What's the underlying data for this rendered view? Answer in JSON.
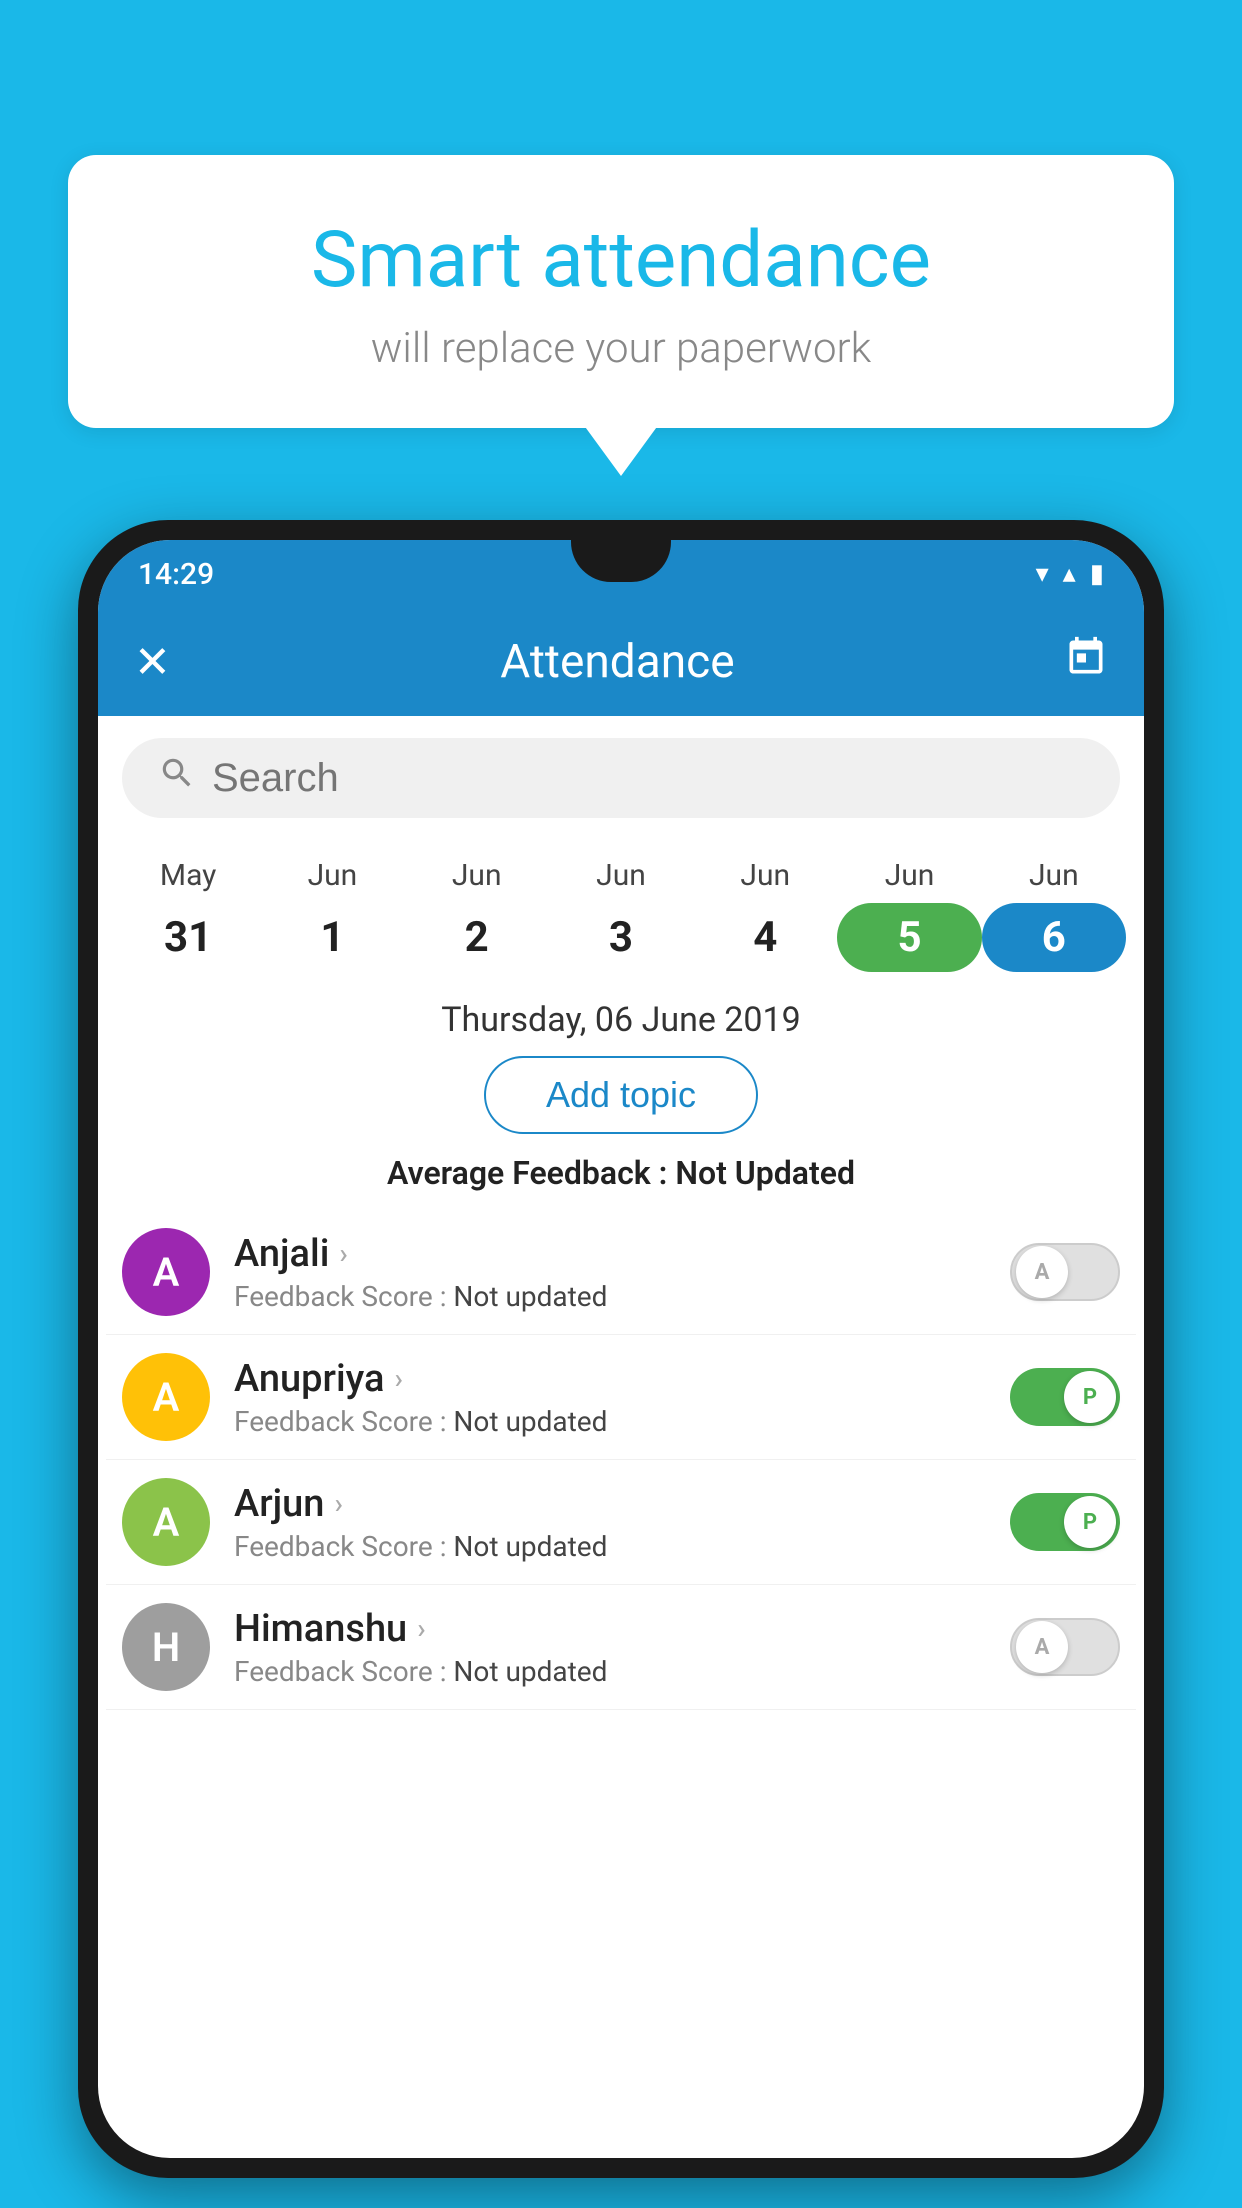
{
  "background_color": "#1ab8e8",
  "bubble": {
    "title": "Smart attendance",
    "subtitle": "will replace your paperwork"
  },
  "phone": {
    "status_bar": {
      "time": "14:29",
      "wifi_icon": "▼",
      "signal_icon": "▲",
      "battery_icon": "▮"
    },
    "app_bar": {
      "close_label": "✕",
      "title": "Attendance",
      "calendar_label": "📅"
    },
    "search": {
      "placeholder": "Search"
    },
    "calendar": {
      "months": [
        "May",
        "Jun",
        "Jun",
        "Jun",
        "Jun",
        "Jun",
        "Jun"
      ],
      "dates": [
        "31",
        "1",
        "2",
        "3",
        "4",
        "5",
        "6"
      ],
      "today_index": 5,
      "selected_index": 6,
      "selected_date_label": "Thursday, 06 June 2019"
    },
    "add_topic_label": "Add topic",
    "average_feedback": {
      "label": "Average Feedback : ",
      "value": "Not Updated"
    },
    "students": [
      {
        "name": "Anjali",
        "avatar_letter": "A",
        "avatar_color": "#9c27b0",
        "feedback_label": "Feedback Score : ",
        "feedback_value": "Not updated",
        "toggle_state": "off",
        "toggle_letter": "A"
      },
      {
        "name": "Anupriya",
        "avatar_letter": "A",
        "avatar_color": "#ffc107",
        "feedback_label": "Feedback Score : ",
        "feedback_value": "Not updated",
        "toggle_state": "on",
        "toggle_letter": "P"
      },
      {
        "name": "Arjun",
        "avatar_letter": "A",
        "avatar_color": "#8bc34a",
        "feedback_label": "Feedback Score : ",
        "feedback_value": "Not updated",
        "toggle_state": "on",
        "toggle_letter": "P"
      },
      {
        "name": "Himanshu",
        "avatar_letter": "H",
        "avatar_color": "#9e9e9e",
        "feedback_label": "Feedback Score : ",
        "feedback_value": "Not updated",
        "toggle_state": "off",
        "toggle_letter": "A"
      }
    ]
  }
}
